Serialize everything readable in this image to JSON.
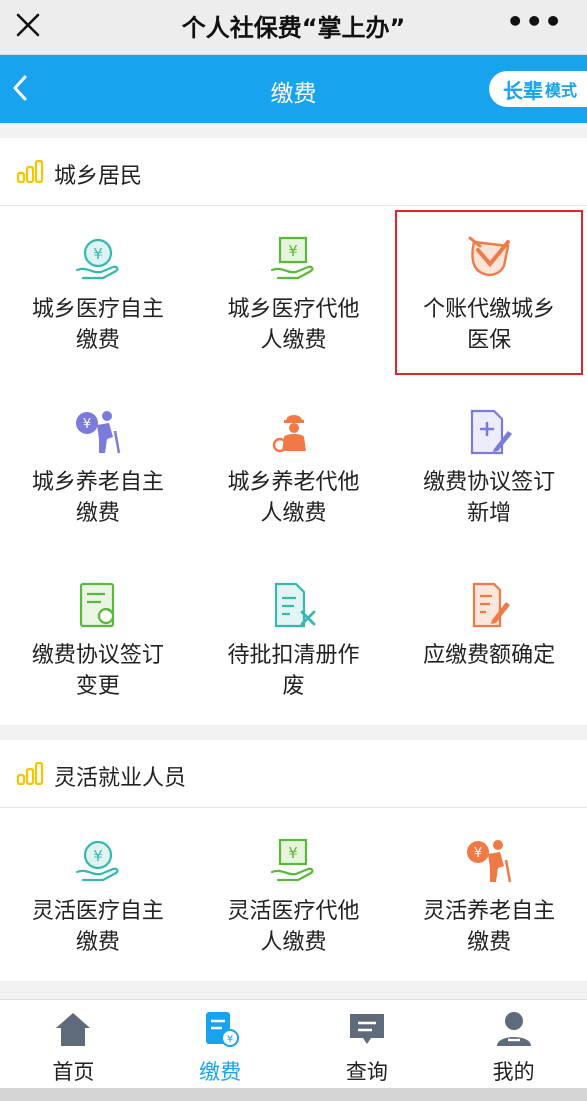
{
  "wechat": {
    "title": "个人社保费“掌上办”",
    "more": "•••"
  },
  "header": {
    "title": "缴费",
    "mode_big": "长辈",
    "mode_small": "模式"
  },
  "colors": {
    "accent": "#18a3ef",
    "teal": "#35b8b0",
    "green": "#58b93a",
    "orange": "#f07a45",
    "purple": "#7b7bdc",
    "highlight": "#e0252b",
    "section_icon": "#f5c600"
  },
  "sections": [
    {
      "title": "城乡居民",
      "icon": "signal-bars-icon",
      "items": [
        {
          "label": "城乡医疗自主缴费",
          "icon": "hand-yuan-icon",
          "color": "teal"
        },
        {
          "label": "城乡医疗代他人缴费",
          "icon": "hand-bill-icon",
          "color": "green"
        },
        {
          "label": "个账代缴城乡医保",
          "icon": "shield-check-icon",
          "color": "orange",
          "highlighted": true
        },
        {
          "label": "城乡养老自主缴费",
          "icon": "elder-yuan-icon",
          "color": "purple"
        },
        {
          "label": "城乡养老代他人缴费",
          "icon": "worker-icon",
          "color": "orange"
        },
        {
          "label": "缴费协议签订新增",
          "icon": "doc-add-icon",
          "color": "purple"
        },
        {
          "label": "缴费协议签订变更",
          "icon": "doc-refresh-icon",
          "color": "green"
        },
        {
          "label": "待批扣清册作废",
          "icon": "doc-cancel-icon",
          "color": "teal"
        },
        {
          "label": "应缴费额确定",
          "icon": "doc-edit-icon",
          "color": "orange"
        }
      ]
    },
    {
      "title": "灵活就业人员",
      "icon": "signal-bars-icon",
      "items": [
        {
          "label": "灵活医疗自主缴费",
          "icon": "hand-yuan-icon",
          "color": "teal"
        },
        {
          "label": "灵活医疗代他人缴费",
          "icon": "hand-bill-icon",
          "color": "green"
        },
        {
          "label": "灵活养老自主缴费",
          "icon": "elder-yuan-icon",
          "color": "orange"
        }
      ]
    }
  ],
  "tabbar": [
    {
      "label": "首页",
      "icon": "home-icon",
      "active": false
    },
    {
      "label": "缴费",
      "icon": "payment-doc-icon",
      "active": true
    },
    {
      "label": "查询",
      "icon": "message-icon",
      "active": false
    },
    {
      "label": "我的",
      "icon": "user-icon",
      "active": false
    }
  ]
}
